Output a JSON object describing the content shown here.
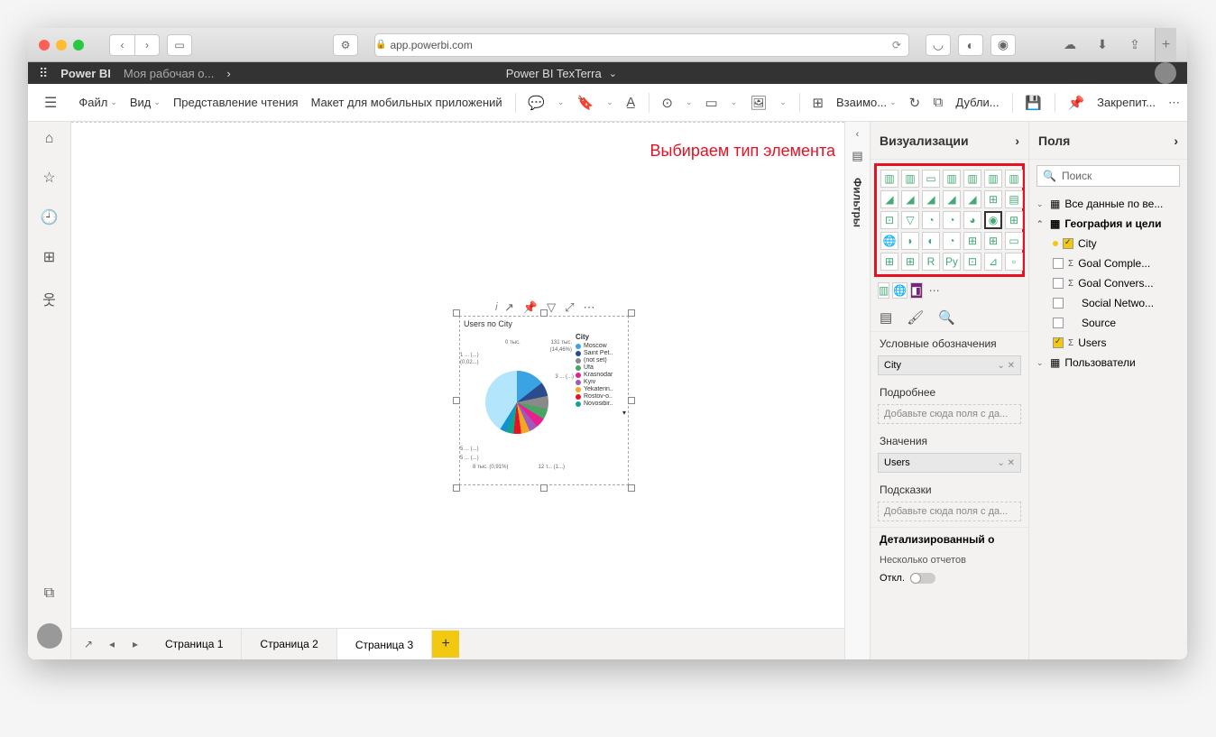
{
  "safari": {
    "url": "app.powerbi.com"
  },
  "pbi": {
    "brand": "Power BI",
    "crumb": "Моя рабочая о...",
    "center": "Power BI TexTerra"
  },
  "ribbon": {
    "file": "Файл",
    "view": "Вид",
    "reading": "Представление чтения",
    "mobile": "Макет для мобильных приложений",
    "interact": "Взаимо...",
    "dupl": "Дубли...",
    "save_ico": "💾",
    "pin": "Закрепит..."
  },
  "annotation": "Выбираем тип элемента",
  "chart": {
    "title": "Users по City",
    "legend_title": "City",
    "legend": [
      {
        "label": "Moscow",
        "color": "#3aa3e3"
      },
      {
        "label": "Saint Pet..",
        "color": "#2a4b8d"
      },
      {
        "label": "(not set)",
        "color": "#8a8a8a"
      },
      {
        "label": "Ufa",
        "color": "#4aa564"
      },
      {
        "label": "Krasnodar",
        "color": "#e91e8f"
      },
      {
        "label": "Kyiv",
        "color": "#9e5cb8"
      },
      {
        "label": "Yekaterin..",
        "color": "#f5a623"
      },
      {
        "label": "Rostov-o..",
        "color": "#e81123"
      },
      {
        "label": "Novosibir..",
        "color": "#13a38f"
      }
    ],
    "labels": [
      "0 тыс.",
      "131 тыс.",
      "(14,46%)",
      "1 ... (...)",
      "(0,02...)",
      "3 ... (...)",
      "5 ... (...)",
      "5 ... (...)",
      "8 тыс. (0,91%)",
      "12 т... (1...)"
    ]
  },
  "pages": {
    "p1": "Страница 1",
    "p2": "Страница 2",
    "p3": "Страница 3"
  },
  "filters_title": "Фильтры",
  "viz_pane": {
    "title": "Визуализации",
    "legend_label": "Условные обозначения",
    "legend_field": "City",
    "details_label": "Подробнее",
    "details_ph": "Добавьте сюда поля с да...",
    "values_label": "Значения",
    "values_field": "Users",
    "tooltips_label": "Подсказки",
    "tooltips_ph": "Добавьте сюда поля с да...",
    "drill_title": "Детализированный о",
    "multi_reports": "Несколько отчетов",
    "off": "Откл."
  },
  "fields": {
    "title": "Поля",
    "search_ph": "Поиск",
    "t1": "Все данные по ве...",
    "t2": "География и цели",
    "city": "City",
    "goalc": "Goal Comple...",
    "goalcv": "Goal Convers...",
    "social": "Social Netwo...",
    "source": "Source",
    "users": "Users",
    "t3": "Пользователи"
  }
}
